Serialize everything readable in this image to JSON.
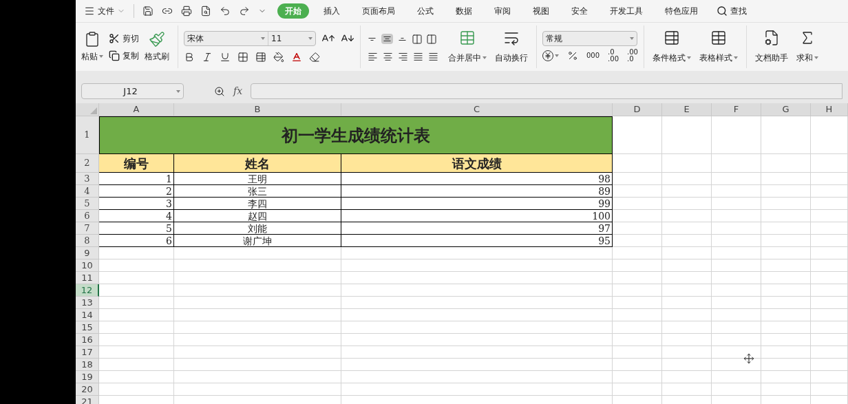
{
  "menu": {
    "file": "文件",
    "tabs": [
      {
        "label": "开始",
        "selected": true
      },
      {
        "label": "插入",
        "selected": false
      },
      {
        "label": "页面布局",
        "selected": false
      },
      {
        "label": "公式",
        "selected": false
      },
      {
        "label": "数据",
        "selected": false
      },
      {
        "label": "审阅",
        "selected": false
      },
      {
        "label": "视图",
        "selected": false
      },
      {
        "label": "安全",
        "selected": false
      },
      {
        "label": "开发工具",
        "selected": false
      },
      {
        "label": "特色应用",
        "selected": false
      }
    ],
    "search": "查找"
  },
  "ribbon": {
    "paste": "粘贴",
    "cut": "剪切",
    "copy": "复制",
    "format_painter": "格式刷",
    "font_name": "宋体",
    "font_size": "11",
    "vertical_align": [
      {
        "kind": "top",
        "selected": false
      },
      {
        "kind": "middle",
        "selected": true
      },
      {
        "kind": "bottom",
        "selected": false
      }
    ],
    "merge": "合并居中",
    "wrap": "自动换行",
    "number_format": "常规",
    "thousands": "000",
    "increase_decimal": [
      ".0",
      ".00"
    ],
    "decrease_decimal": [
      ".00",
      ".0"
    ],
    "conditional_format": "条件格式",
    "table_style": "表格样式",
    "doc_helper": "文档助手",
    "sum": "求和"
  },
  "formula_bar": {
    "name_box": "J12",
    "fx": "fx"
  },
  "sheet": {
    "columns": [
      "A",
      "B",
      "C",
      "D",
      "E",
      "F",
      "G",
      "H"
    ],
    "row_headers": [
      {
        "label": "1",
        "selected": false
      },
      {
        "label": "2",
        "selected": false
      },
      {
        "label": "3",
        "selected": false
      },
      {
        "label": "4",
        "selected": false
      },
      {
        "label": "5",
        "selected": false
      },
      {
        "label": "6",
        "selected": false
      },
      {
        "label": "7",
        "selected": false
      },
      {
        "label": "8",
        "selected": false
      },
      {
        "label": "9",
        "selected": false
      },
      {
        "label": "10",
        "selected": false
      },
      {
        "label": "11",
        "selected": false
      },
      {
        "label": "12",
        "selected": true
      },
      {
        "label": "13",
        "selected": false
      },
      {
        "label": "14",
        "selected": false
      },
      {
        "label": "15",
        "selected": false
      },
      {
        "label": "16",
        "selected": false
      },
      {
        "label": "17",
        "selected": false
      },
      {
        "label": "18",
        "selected": false
      },
      {
        "label": "19",
        "selected": false
      },
      {
        "label": "20",
        "selected": false
      },
      {
        "label": "21",
        "selected": false
      }
    ],
    "title": "初一学生成绩统计表",
    "headers": [
      "编号",
      "姓名",
      "语文成绩"
    ],
    "rows": [
      [
        "1",
        "王明",
        "98"
      ],
      [
        "2",
        "张三",
        "89"
      ],
      [
        "3",
        "李四",
        "99"
      ],
      [
        "4",
        "赵四",
        "100"
      ],
      [
        "5",
        "刘能",
        "97"
      ],
      [
        "6",
        "谢广坤",
        "95"
      ]
    ]
  }
}
